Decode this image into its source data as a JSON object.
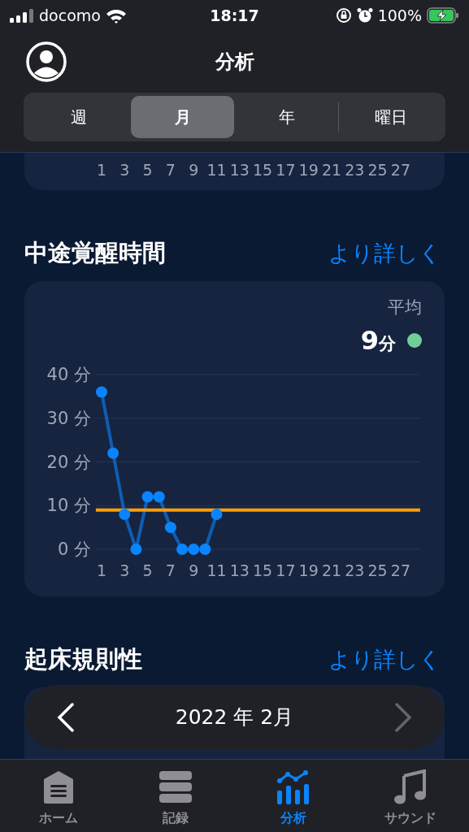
{
  "status_bar": {
    "carrier": "docomo",
    "time": "18:17",
    "battery": "100%"
  },
  "header": {
    "title": "分析"
  },
  "tabs": [
    {
      "label": "週",
      "selected": false
    },
    {
      "label": "月",
      "selected": true
    },
    {
      "label": "年",
      "selected": false
    },
    {
      "label": "曜日",
      "selected": false
    }
  ],
  "top_chart": {
    "xticks": [
      "1",
      "3",
      "5",
      "7",
      "9",
      "11",
      "13",
      "15",
      "17",
      "19",
      "21",
      "23",
      "25",
      "27"
    ]
  },
  "sections": [
    {
      "title": "中途覚醒時間",
      "more_link": "より詳しく",
      "average": {
        "label": "平均",
        "value": "9",
        "unit": "分",
        "color": "#6fcf97"
      },
      "chart_data": {
        "type": "line",
        "x": [
          1,
          2,
          3,
          4,
          5,
          6,
          7,
          8,
          9,
          10,
          11
        ],
        "series": [
          {
            "color": "#0a84ff",
            "marker": "o",
            "values": [
              36,
              22,
              8,
              0,
              12,
              12,
              5,
              0,
              0,
              0,
              8
            ]
          }
        ],
        "xlim": [
          0.5,
          28.7
        ],
        "ylim": [
          0,
          40
        ],
        "grid": true,
        "xticks": [
          1,
          3,
          5,
          7,
          9,
          11,
          13,
          15,
          17,
          19,
          21,
          23,
          25,
          27
        ],
        "yticks": [
          {
            "value": 0,
            "label": "0 分"
          },
          {
            "value": 10,
            "label": "10 分"
          },
          {
            "value": 20,
            "label": "20 分"
          },
          {
            "value": 30,
            "label": "30 分"
          },
          {
            "value": 40,
            "label": "40 分"
          }
        ],
        "ref_lines": [
          {
            "axis": "y",
            "value": 9,
            "color": "#ff9f0a"
          }
        ]
      }
    },
    {
      "title": "起床規則性",
      "more_link": "より詳しく"
    }
  ],
  "month_nav": {
    "label": "2022 年 2月",
    "prev_disabled": false,
    "next_disabled": true
  },
  "tab_bar": [
    {
      "label": "ホーム",
      "kind": "home",
      "selected": false
    },
    {
      "label": "記録",
      "kind": "list",
      "selected": false
    },
    {
      "label": "分析",
      "kind": "chart",
      "selected": true
    },
    {
      "label": "サウンド",
      "kind": "music",
      "selected": false
    }
  ]
}
